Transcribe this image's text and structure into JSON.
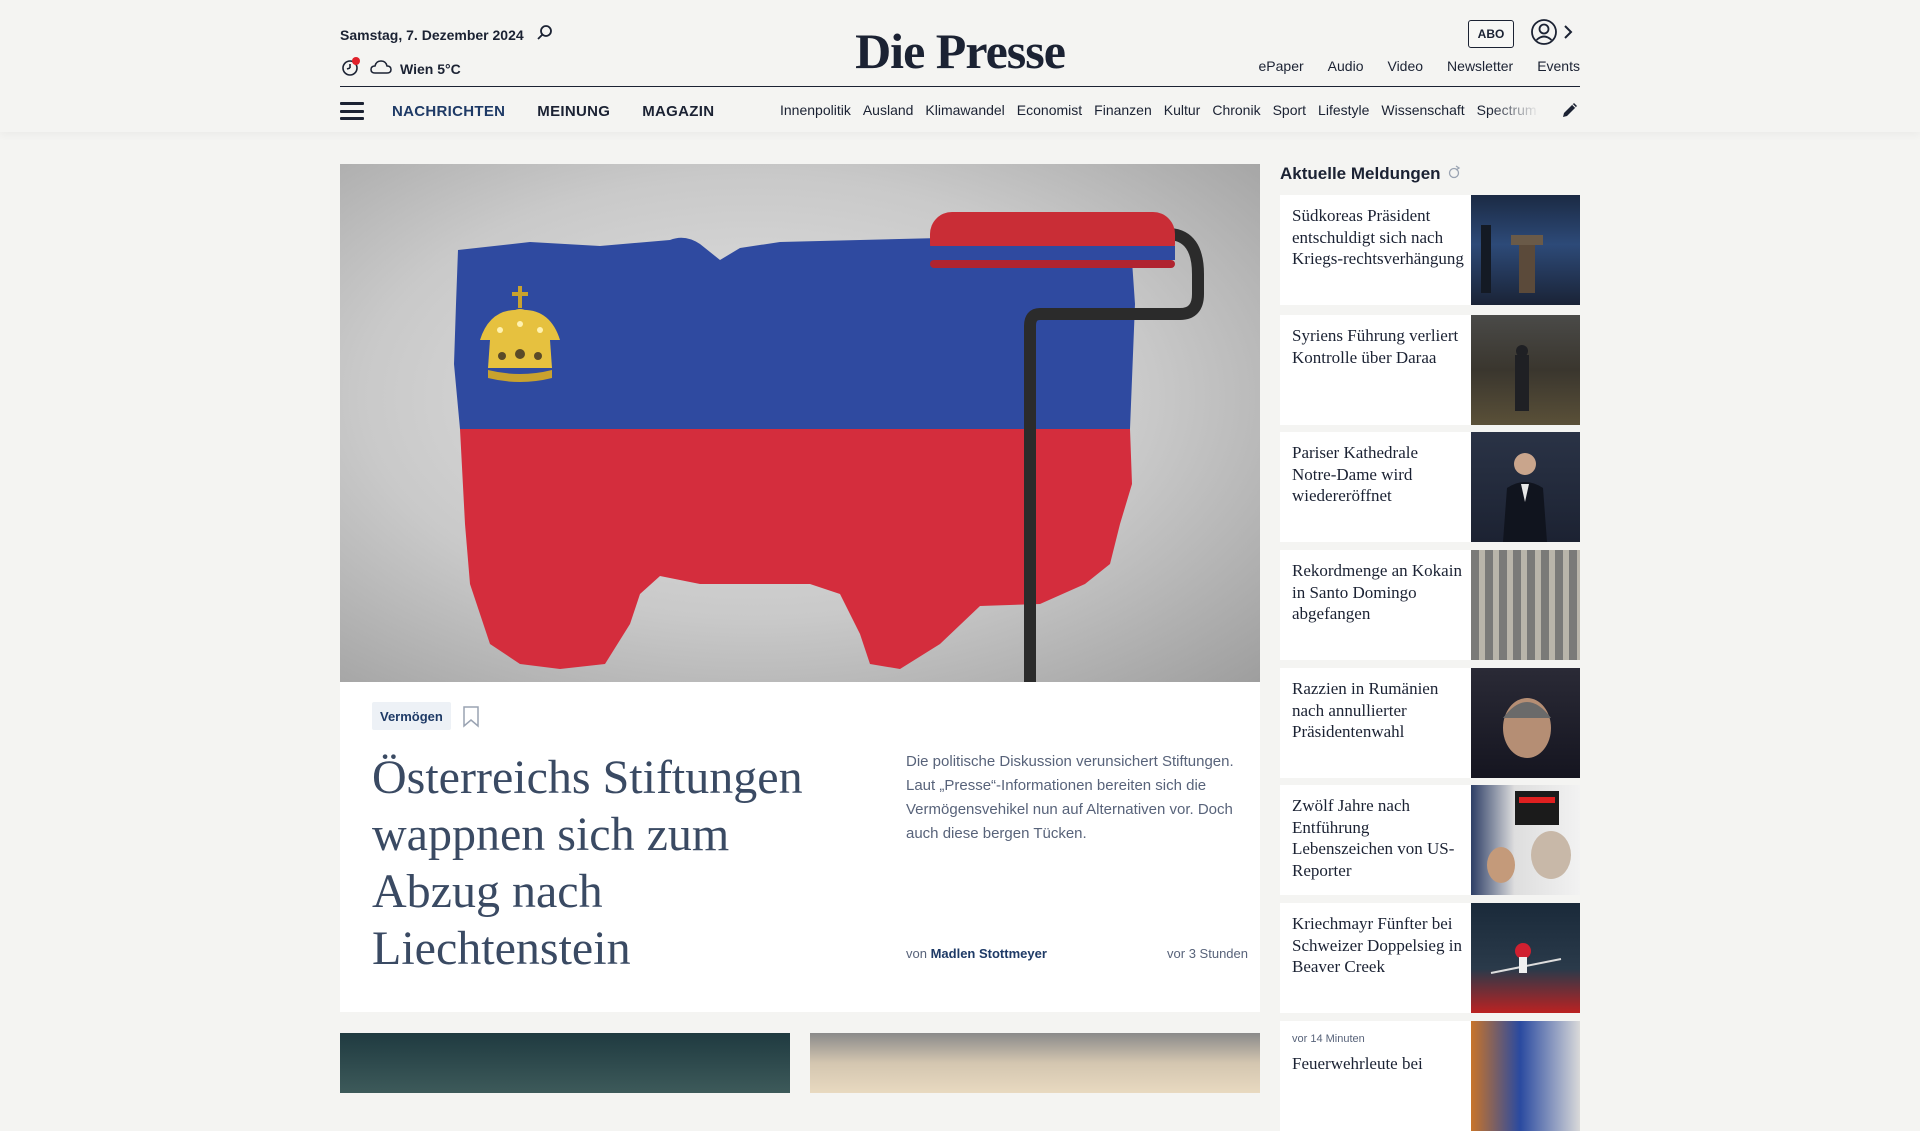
{
  "header": {
    "date": "Samstag, 7. Dezember 2024",
    "weather": "Wien 5°C",
    "logo": "Die Presse",
    "abo_label": "ABO",
    "top_links": [
      "ePaper",
      "Audio",
      "Video",
      "Newsletter",
      "Events"
    ],
    "main_nav": [
      "NACHRICHTEN",
      "MEINUNG",
      "MAGAZIN"
    ],
    "sub_nav": [
      "Innenpolitik",
      "Ausland",
      "Klimawandel",
      "Economist",
      "Finanzen",
      "Kultur",
      "Chronik",
      "Sport",
      "Lifestyle",
      "Wissenschaft",
      "Spectrum"
    ]
  },
  "hero": {
    "tag": "Vermögen",
    "headline": "Österreichs Stiftungen wappnen sich zum Abzug nach Liechtenstein",
    "lead": "Die politische Diskussion verunsichert Stiftungen. Laut „Presse“-Informationen bereiten sich die Vermögensvehikel nun auf Alternativen vor. Doch auch diese bergen Tücken.",
    "byline_prefix": "von",
    "author": "Madlen Stottmeyer",
    "age": "vor 3 Stunden"
  },
  "sidebar": {
    "title": "Aktuelle Meldungen",
    "items": [
      {
        "text": "Südkoreas Präsident entschuldigt sich nach Kriegs-rechtsverhängung"
      },
      {
        "text": "Syriens Führung verliert Kontrolle über Daraa"
      },
      {
        "text": "Pariser Kathedrale Notre-Dame wird wiedereröffnet"
      },
      {
        "text": "Rekordmenge an Kokain in Santo Domingo abgefangen"
      },
      {
        "text": "Razzien in Rumänien nach annullierter Präsidentenwahl"
      },
      {
        "text": "Zwölf Jahre nach Entführung Lebenszeichen von US-Reporter"
      },
      {
        "text": "Kriechmayr Fünfter bei Schweizer Doppelsieg in Beaver Creek"
      },
      {
        "text": "Feuerwehrleute bei",
        "timestamp": "vor 14 Minuten"
      }
    ]
  },
  "colors": {
    "accent": "#1e3a66",
    "background": "#f4f4f2",
    "flag_blue": "#2f4aa0",
    "flag_red": "#d42d3d",
    "crown_gold": "#e6c13f"
  }
}
